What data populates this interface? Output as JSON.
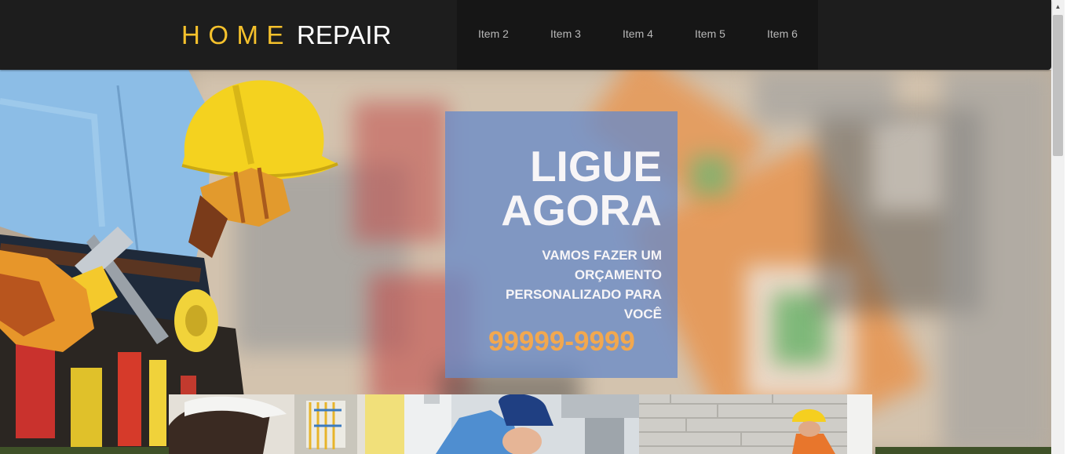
{
  "header": {
    "logo": {
      "word1": "HOME",
      "word2": "REPAIR"
    },
    "nav": [
      {
        "label": "Item 2"
      },
      {
        "label": "Item 3"
      },
      {
        "label": "Item 4"
      },
      {
        "label": "Item 5"
      },
      {
        "label": "Item 6"
      }
    ]
  },
  "hero": {
    "title": "LIGUE AGORA",
    "subtitle": "VAMOS FAZER UM ORÇAMENTO PERSONALIZADO PARA VOCÊ",
    "phone": "99999-9999"
  },
  "colors": {
    "header_bg": "#1d1d1d",
    "logo_accent": "#f5c12c",
    "cta_panel": "#698ac8",
    "phone": "#f2a84f"
  }
}
